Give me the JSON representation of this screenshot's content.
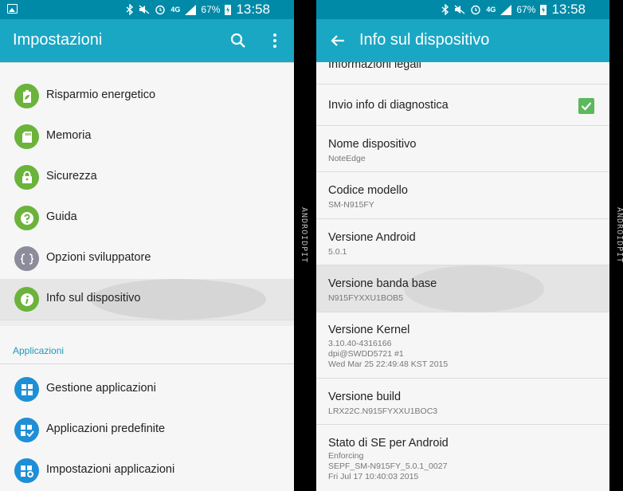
{
  "status_bar": {
    "network": "4G",
    "battery": "67%",
    "time": "13:58"
  },
  "left_screen": {
    "title": "Impostazioni",
    "items": [
      {
        "label": "Risparmio energetico",
        "icon": "battery-leaf-icon",
        "color": "#6bb33b"
      },
      {
        "label": "Memoria",
        "icon": "sd-card-icon",
        "color": "#6bb33b"
      },
      {
        "label": "Sicurezza",
        "icon": "lock-icon",
        "color": "#6bb33b"
      },
      {
        "label": "Guida",
        "icon": "question-icon",
        "color": "#6bb33b"
      },
      {
        "label": "Opzioni sviluppatore",
        "icon": "braces-icon",
        "color": "#8c8c9c"
      },
      {
        "label": "Info sul dispositivo",
        "icon": "info-icon",
        "color": "#6bb33b"
      }
    ],
    "section_header": "Applicazioni",
    "app_items": [
      {
        "label": "Gestione applicazioni",
        "icon": "grid-icon",
        "color": "#1e8fd6"
      },
      {
        "label": "Applicazioni predefinite",
        "icon": "grid-check-icon",
        "color": "#1e8fd6"
      },
      {
        "label": "Impostazioni applicazioni",
        "icon": "grid-gear-icon",
        "color": "#1e8fd6"
      }
    ]
  },
  "right_screen": {
    "title": "Info sul dispositivo",
    "partial_item": "Informazioni legali",
    "diagnostics": {
      "label": "Invio info di diagnostica",
      "checked": true
    },
    "items": [
      {
        "title": "Nome dispositivo",
        "lines": [
          "NoteEdge"
        ]
      },
      {
        "title": "Codice modello",
        "lines": [
          "SM-N915FY"
        ]
      },
      {
        "title": "Versione Android",
        "lines": [
          "5.0.1"
        ]
      },
      {
        "title": "Versione banda base",
        "lines": [
          "N915FYXXU1BOB5"
        ]
      },
      {
        "title": "Versione Kernel",
        "lines": [
          "3.10.40-4316166",
          "dpi@SWDD5721 #1",
          "Wed Mar 25 22:49:48 KST 2015"
        ]
      },
      {
        "title": "Versione build",
        "lines": [
          "LRX22C.N915FYXXU1BOC3"
        ]
      },
      {
        "title": "Stato di SE per Android",
        "lines": [
          "Enforcing",
          "SEPF_SM-N915FY_5.0.1_0027",
          "Fri Jul 17 10:40:03 2015"
        ]
      }
    ]
  },
  "watermark": "ANDROIDPIT"
}
